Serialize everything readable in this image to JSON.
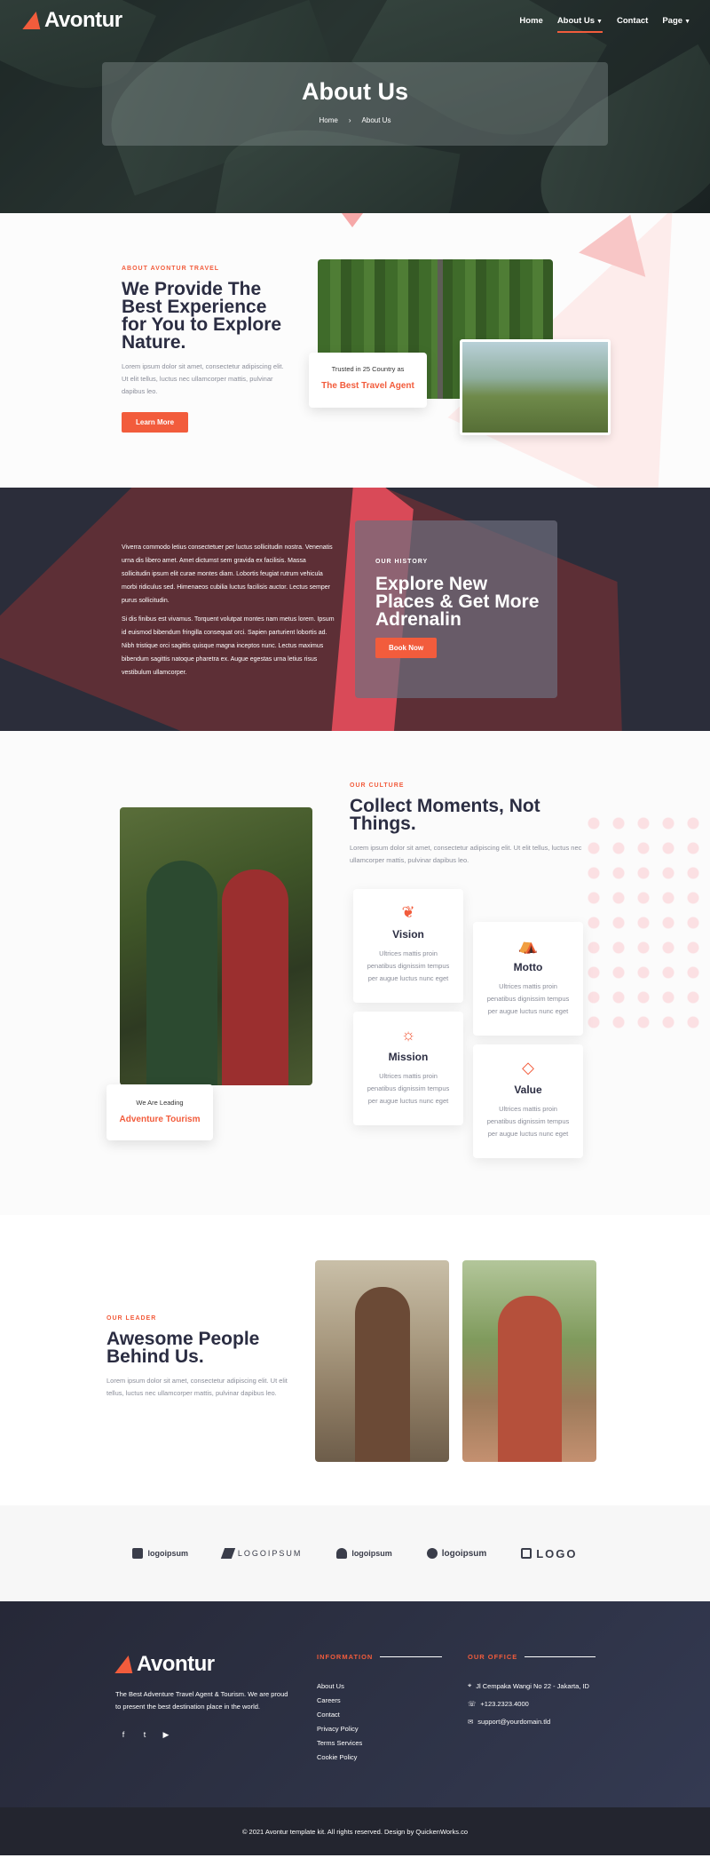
{
  "nav": {
    "logo": "Avontur",
    "items": [
      {
        "label": "Home",
        "dropdown": false,
        "active": false
      },
      {
        "label": "About Us",
        "dropdown": true,
        "active": true
      },
      {
        "label": "Contact",
        "dropdown": false,
        "active": false
      },
      {
        "label": "Page",
        "dropdown": true,
        "active": false
      }
    ]
  },
  "hero": {
    "title": "About Us",
    "breadcrumb": [
      "Home",
      "About Us"
    ]
  },
  "about": {
    "eyebrow": "ABOUT AVONTUR TRAVEL",
    "title": "We Provide The Best Experience for You to Explore Nature.",
    "text": "Lorem ipsum dolor sit amet, consectetur adipiscing elit. Ut elit tellus, luctus nec ullamcorper mattis, pulvinar dapibus leo.",
    "button": "Learn More",
    "trust_line": "Trusted in 25 Country as",
    "trust_highlight": "The Best Travel Agent"
  },
  "history": {
    "para1": "Viverra commodo letius consectetuer per luctus sollicitudin nostra. Venenatis urna dis libero amet. Amet dictumst sem gravida ex facilisis. Massa sollicitudin ipsum elit curae montes diam. Lobortis feugiat rutrum vehicula morbi ridiculus sed. Himenaeos cubilia luctus facilisis auctor. Lectus semper purus sollicitudin.",
    "para2": "Si dis finibus est vivamus. Torquent volutpat montes nam metus lorem. Ipsum id euismod bibendum fringilla consequat orci. Sapien parturient lobortis ad. Nibh tristique orci sagittis quisque magna inceptos nunc. Lectus maximus bibendum sagittis natoque pharetra ex. Augue egestas urna letius risus vestibulum ullamcorper.",
    "eyebrow": "OUR HISTORY",
    "title": "Explore New Places & Get More Adrenalin",
    "button": "Book Now"
  },
  "culture": {
    "eyebrow": "OUR CULTURE",
    "title": "Collect Moments, Not Things.",
    "text": "Lorem ipsum dolor sit amet, consectetur adipiscing elit. Ut elit tellus, luctus nec ullamcorper mattis, pulvinar dapibus leo.",
    "lead_line": "We Are Leading",
    "lead_highlight": "Adventure Tourism",
    "cards": [
      {
        "title": "Vision",
        "icon": "laurel-icon",
        "text": "Ultrices mattis proin penatibus dignissim tempus per augue luctus nunc eget"
      },
      {
        "title": "Motto",
        "icon": "campfire-icon",
        "text": "Ultrices mattis proin penatibus dignissim tempus per augue luctus nunc eget"
      },
      {
        "title": "Mission",
        "icon": "lightbulb-icon",
        "text": "Ultrices mattis proin penatibus dignissim tempus per augue luctus nunc eget"
      },
      {
        "title": "Value",
        "icon": "diamond-icon",
        "text": "Ultrices mattis proin penatibus dignissim tempus per augue luctus nunc eget"
      }
    ]
  },
  "leader": {
    "eyebrow": "OUR LEADER",
    "title": "Awesome People Behind Us.",
    "text": "Lorem ipsum dolor sit amet, consectetur adipiscing elit. Ut elit tellus, luctus nec ullamcorper mattis, pulvinar dapibus leo."
  },
  "logos": [
    "logoipsum",
    "LOGOIPSUM",
    "logoipsum",
    "logoipsum",
    "LOGO"
  ],
  "footer": {
    "logo": "Avontur",
    "about": "The Best Adventure Travel Agent & Tourism. We are proud to present the best destination place in the world.",
    "info_heading": "INFORMATION",
    "info_links": [
      "About Us",
      "Careers",
      "Contact",
      "Privacy Policy",
      "Terms Services",
      "Cookie Policy"
    ],
    "office_heading": "OUR OFFICE",
    "office": [
      {
        "icon": "map-pin-icon",
        "text": "Jl Cempaka Wangi No 22 - Jakarta, ID"
      },
      {
        "icon": "phone-icon",
        "text": "+123.2323.4000"
      },
      {
        "icon": "mail-icon",
        "text": "support@yourdomain.tld"
      }
    ],
    "copyright": "© 2021 Avontur template kit. All rights reserved. Design by QuickenWorks.co"
  },
  "colors": {
    "accent": "#f25c3c",
    "dark": "#2b2d3a"
  }
}
